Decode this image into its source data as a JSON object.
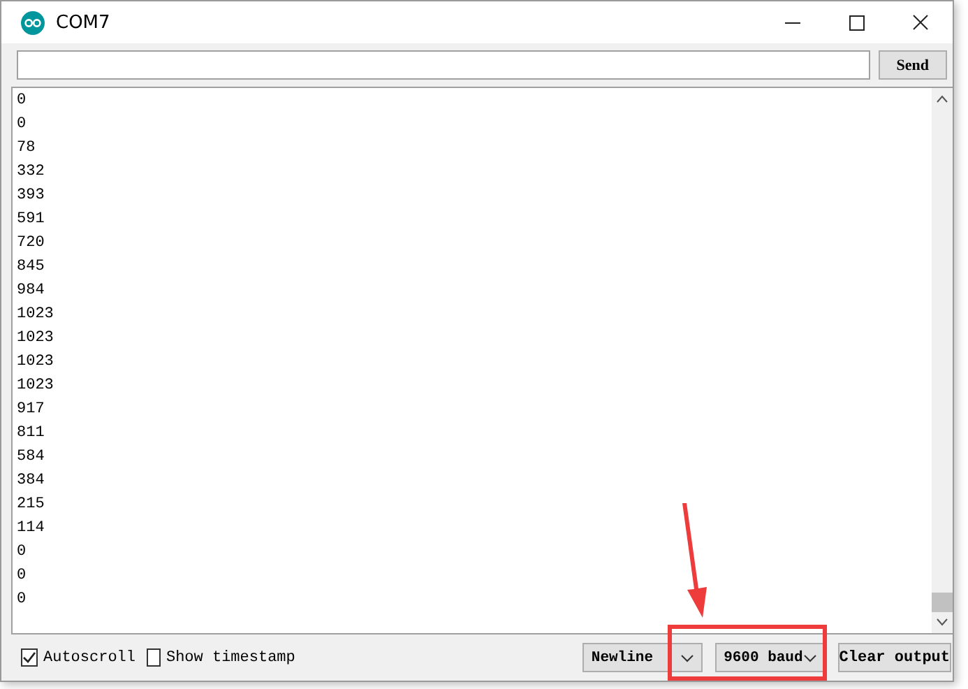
{
  "window": {
    "title": "COM7"
  },
  "send_button": "Send",
  "output_lines": [
    "0",
    "0",
    "78",
    "332",
    "393",
    "591",
    "720",
    "845",
    "984",
    "1023",
    "1023",
    "1023",
    "1023",
    "917",
    "811",
    "584",
    "384",
    "215",
    "114",
    "0",
    "0",
    "0"
  ],
  "footer": {
    "autoscroll": {
      "label": "Autoscroll",
      "checked": true
    },
    "timestamp": {
      "label": "Show timestamp",
      "checked": false
    },
    "line_ending": "Newline",
    "baud_rate": {
      "value": "9600 baud",
      "highlighted": true
    },
    "clear_button": "Clear output"
  }
}
